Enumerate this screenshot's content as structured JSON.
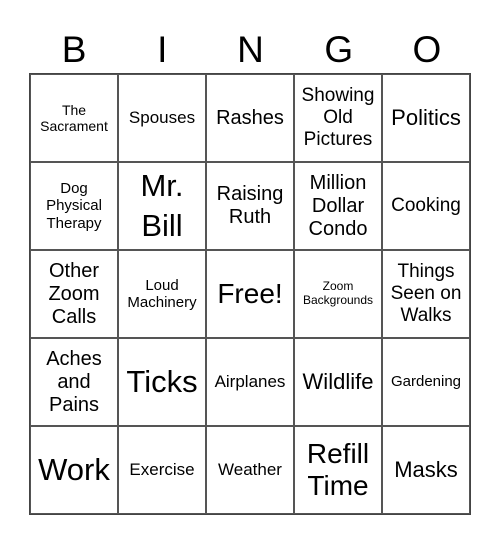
{
  "header": [
    "B",
    "I",
    "N",
    "G",
    "O"
  ],
  "cells": [
    [
      "The Sacrament",
      "Spouses",
      "Rashes",
      "Showing Old Pictures",
      "Politics"
    ],
    [
      "Dog Physical Therapy",
      "Mr. Bill",
      "Raising Ruth",
      "Million Dollar Condo",
      "Cooking"
    ],
    [
      "Other Zoom Calls",
      "Loud Machinery",
      "Free!",
      "Zoom Backgrounds",
      "Things Seen on Walks"
    ],
    [
      "Aches and Pains",
      "Ticks",
      "Airplanes",
      "Wildlife",
      "Gardening"
    ],
    [
      "Work",
      "Exercise",
      "Weather",
      "Refill Time",
      "Masks"
    ]
  ]
}
